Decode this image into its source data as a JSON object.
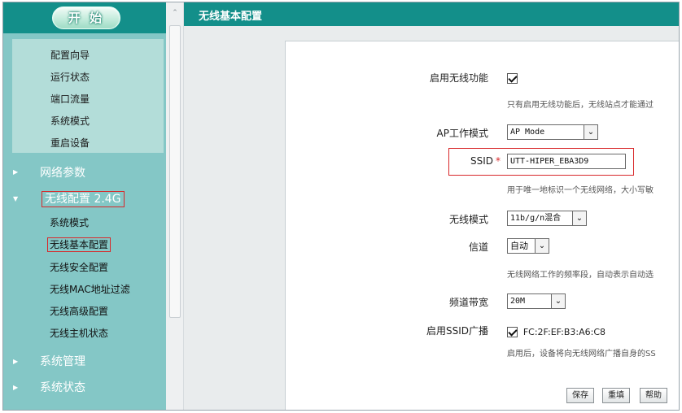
{
  "sidebar": {
    "start_label": "开 始",
    "quick_items": [
      "配置向导",
      "运行状态",
      "端口流量",
      "系统模式",
      "重启设备"
    ],
    "groups": {
      "network": "网络参数",
      "wireless": "无线配置 2.4G",
      "system_mgmt": "系统管理",
      "system_status": "系统状态"
    },
    "wireless_items": [
      "系统模式",
      "无线基本配置",
      "无线安全配置",
      "无线MAC地址过滤",
      "无线高级配置",
      "无线主机状态"
    ]
  },
  "main": {
    "title": "无线基本配置",
    "form": {
      "enable_wireless_label": "启用无线功能",
      "enable_wireless_hint": "只有启用无线功能后，无线站点才能通过",
      "ap_mode_label": "AP工作模式",
      "ap_mode_value": "AP Mode",
      "ssid_label": "SSID",
      "ssid_required_mark": "*",
      "ssid_value": "UTT-HIPER_EBA3D9",
      "ssid_hint": "用于唯一地标识一个无线网络，大小写敏",
      "wireless_mode_label": "无线模式",
      "wireless_mode_value": "11b/g/n混合",
      "channel_label": "信道",
      "channel_value": "自动",
      "channel_hint": "无线网络工作的频率段，自动表示自动选",
      "bandwidth_label": "频道带宽",
      "bandwidth_value": "20M",
      "ssid_broadcast_label": "启用SSID广播",
      "ssid_broadcast_mac": "FC:2F:EF:B3:A6:C8",
      "ssid_broadcast_hint": "启用后，设备将向无线网络广播自身的SS"
    },
    "buttons": {
      "save": "保存",
      "reset": "重填",
      "help": "帮助"
    }
  },
  "colors": {
    "header_teal": "#138f8a",
    "sidebar_bg": "#84c7c6",
    "highlight_red": "#d8282a"
  },
  "icons": {
    "nav_collapsed": "triangle-right",
    "nav_expanded": "triangle-down",
    "scroll_up": "chevron-up",
    "dropdown": "chevron-down"
  }
}
